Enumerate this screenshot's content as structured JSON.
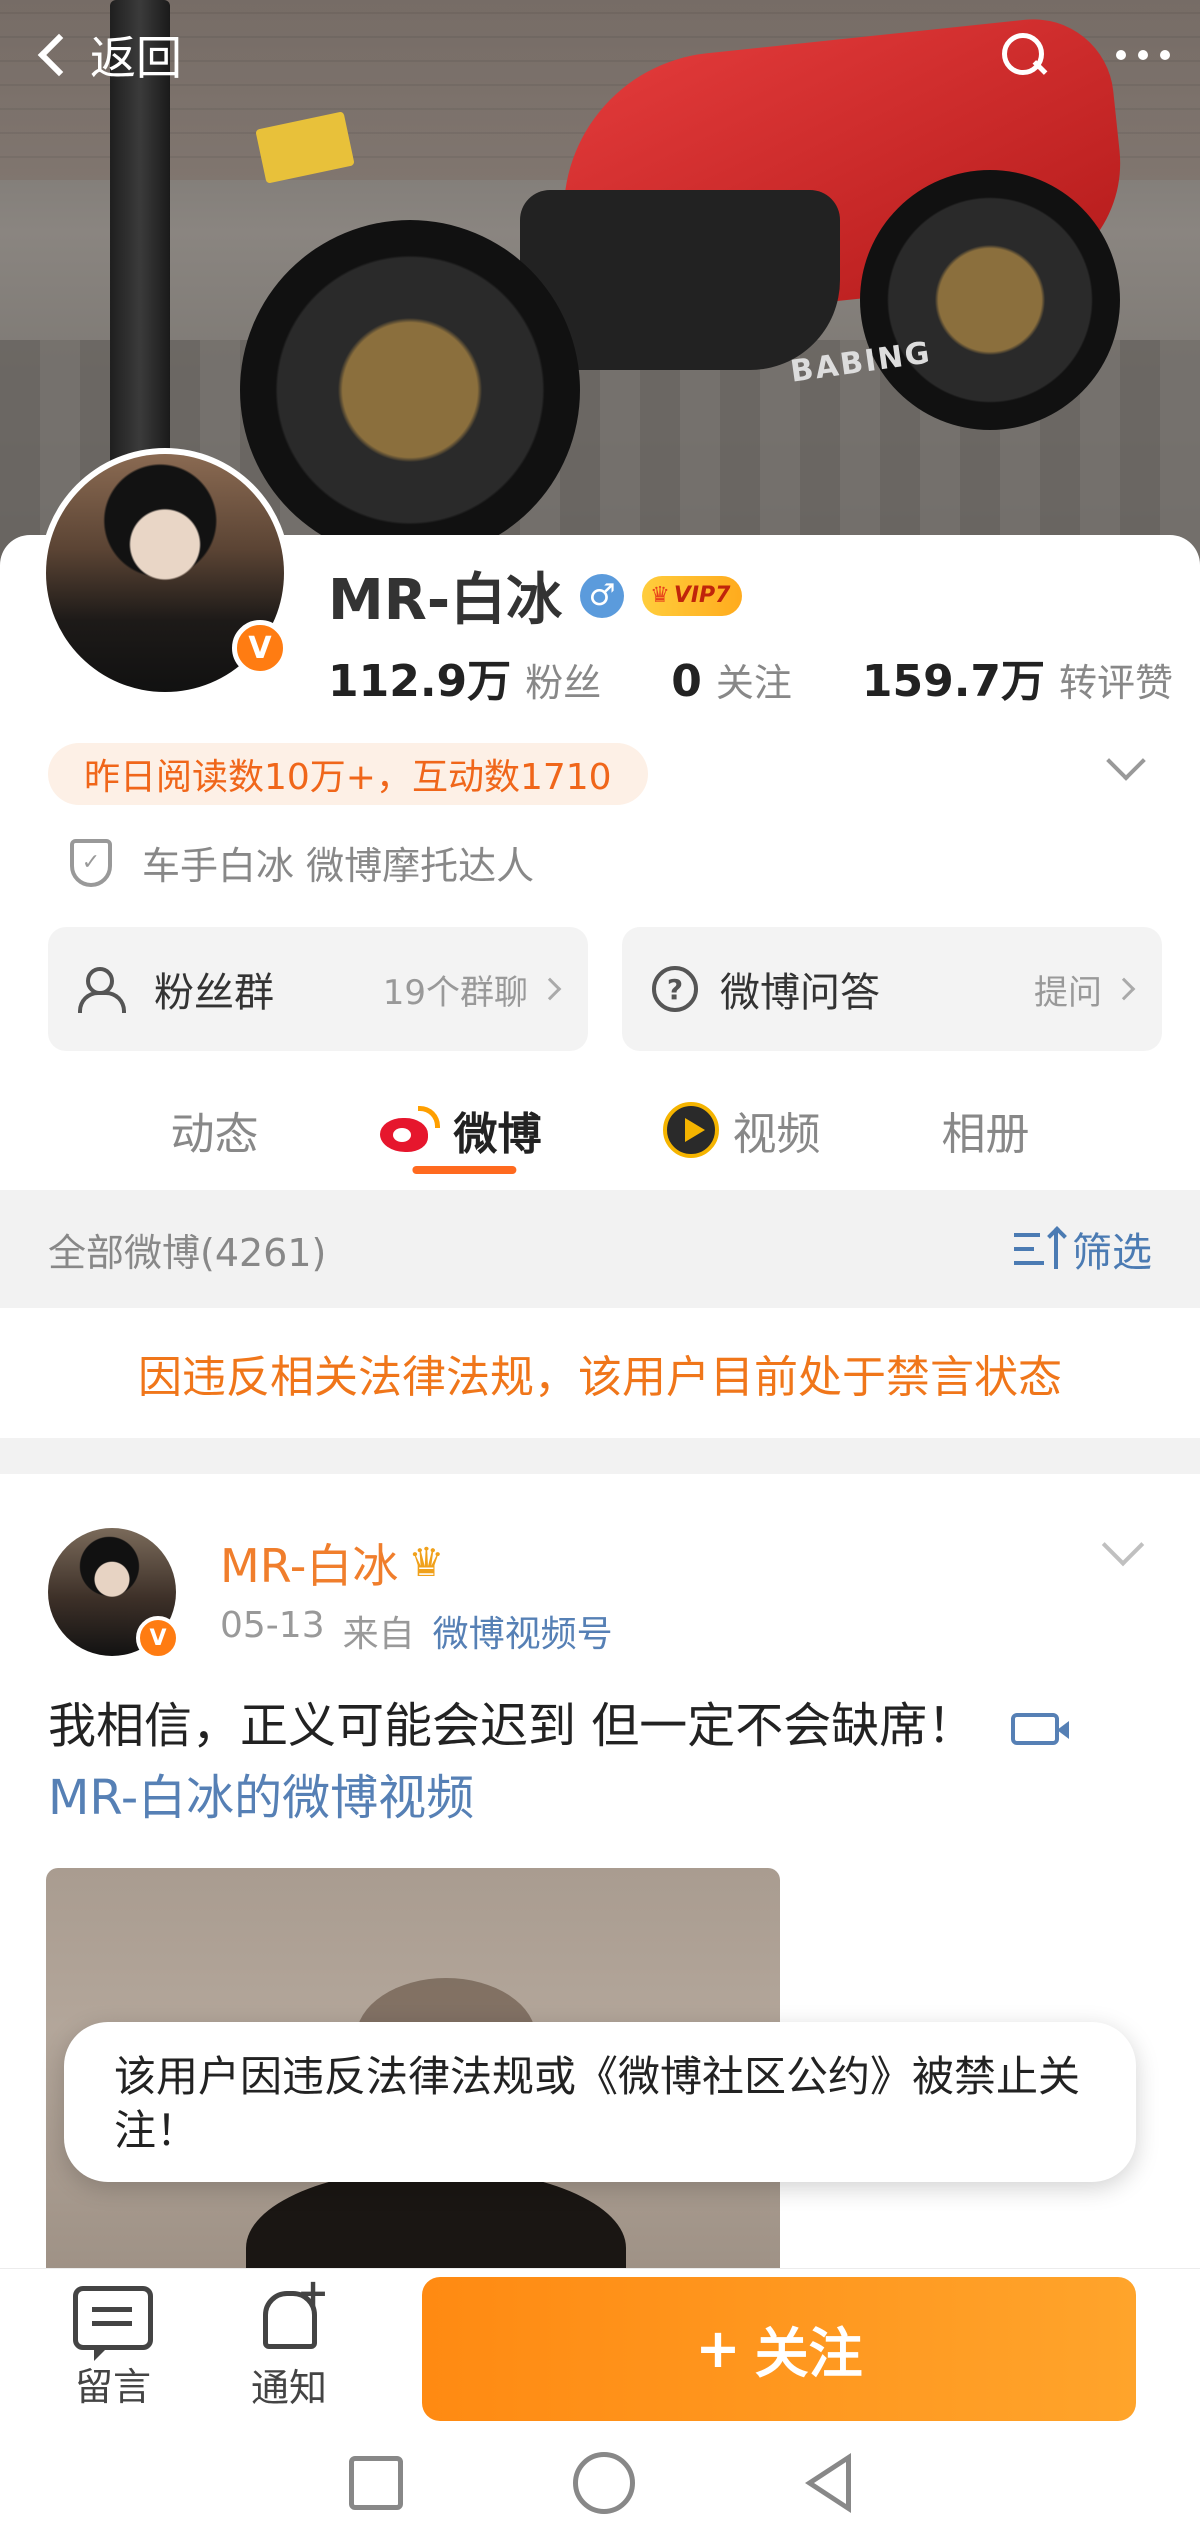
{
  "header": {
    "back_label": "返回",
    "cover_brand_text": "BABING"
  },
  "profile": {
    "name": "MR-白冰",
    "gender_icon": "male-icon",
    "vip_label": "VIP7",
    "verified_icon": "verified-v-icon",
    "verified_letter": "V",
    "stats": [
      {
        "value": "112.9万",
        "label": "粉丝"
      },
      {
        "value": "0",
        "label": "关注"
      },
      {
        "value": "159.7万",
        "label": "转评赞"
      }
    ],
    "highlight": "昨日阅读数10万+，互动数1710",
    "certification": "车手白冰 微博摩托达人",
    "cards": [
      {
        "title": "粉丝群",
        "action": "19个群聊",
        "icon": "group-icon"
      },
      {
        "title": "微博问答",
        "action": "提问",
        "icon": "question-icon"
      }
    ]
  },
  "tabs": [
    {
      "label": "动态",
      "active": false
    },
    {
      "label": "微博",
      "active": true,
      "icon": "weibo-logo-icon"
    },
    {
      "label": "视频",
      "active": false,
      "icon": "video-channel-icon"
    },
    {
      "label": "相册",
      "active": false
    }
  ],
  "filter": {
    "count_label": "全部微博(4261)",
    "filter_label": "筛选"
  },
  "ban_notice": "因违反相关法律法规，该用户目前处于禁言状态",
  "post": {
    "author": "MR-白冰",
    "date": "05-13",
    "from_label": "来自",
    "source": "微博视频号",
    "text": "我相信，正义可能会迟到 但一定不会缺席！",
    "link": "MR-白冰的微博视频"
  },
  "toast": "该用户因违反法律法规或《微博社区公约》被禁止关注！",
  "bottom_bar": {
    "message_label": "留言",
    "notify_label": "通知",
    "follow_plus": "+",
    "follow_label": "关注"
  },
  "colors": {
    "accent_orange": "#ff8a12",
    "link_blue": "#5680b5",
    "weibo_red": "#e6162d"
  }
}
